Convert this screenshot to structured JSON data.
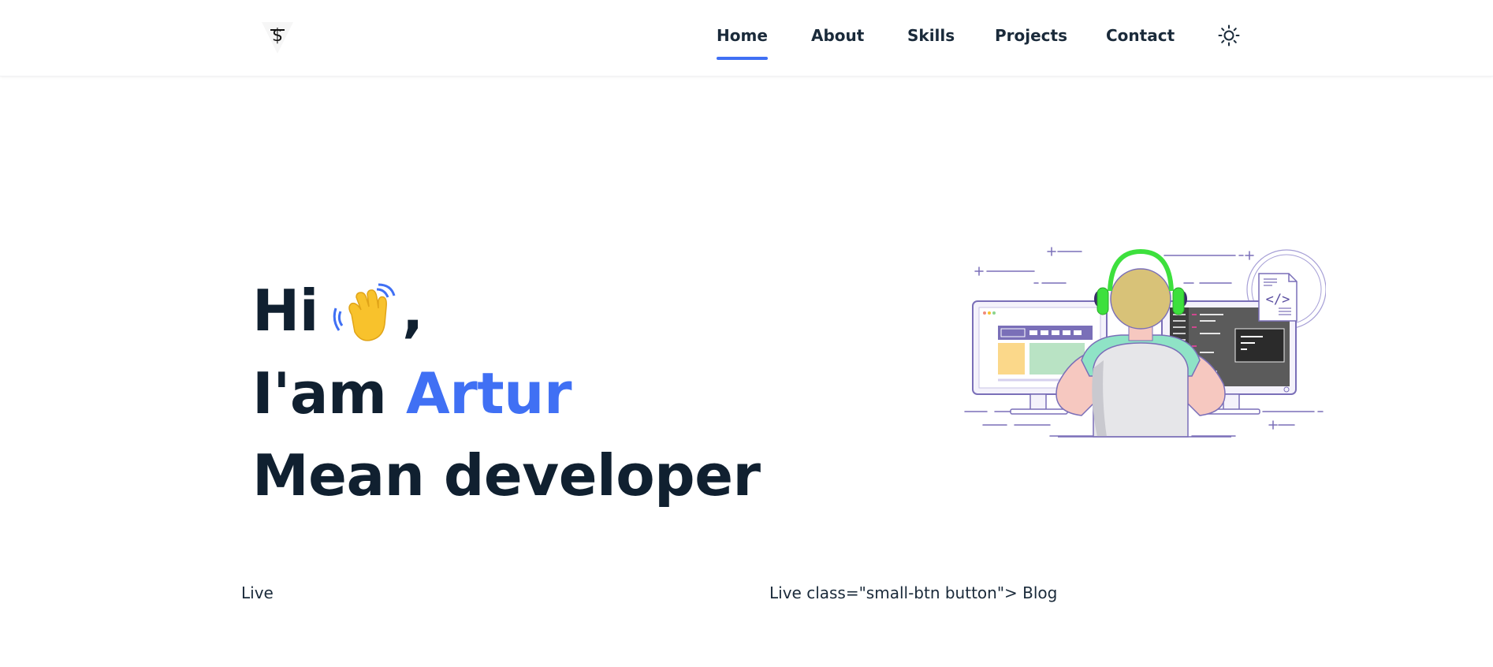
{
  "colors": {
    "accent": "#4070f4",
    "text": "#102030"
  },
  "header": {
    "logo_icon": "dollar-triangle-logo",
    "nav": [
      {
        "label": "Home",
        "active": true
      },
      {
        "label": "About",
        "active": false
      },
      {
        "label": "Skills",
        "active": false
      },
      {
        "label": "Projects",
        "active": false
      },
      {
        "label": "Contact",
        "active": false
      }
    ],
    "theme_icon": "sun-icon"
  },
  "hero": {
    "greeting": "Hi",
    "greeting_emoji": "waving-hand-icon",
    "greeting_comma": ",",
    "intro_prefix": "I'am",
    "name": "Artur",
    "role": "Mean developer",
    "illustration": "developer-at-desk-illustration"
  },
  "footer_links": {
    "left_text": "Live",
    "right_text": "Live class=\"small-btn button\"> Blog"
  }
}
